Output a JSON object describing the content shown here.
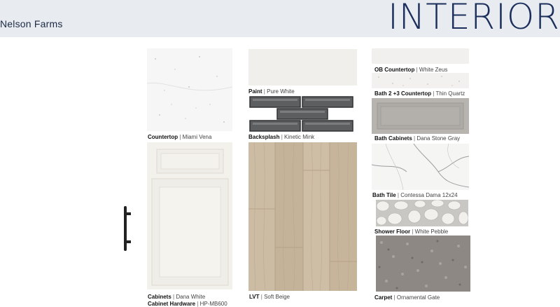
{
  "header": {
    "community": "Nelson Farms",
    "title": "INTERIOR"
  },
  "col1": {
    "countertop": {
      "label": "Countertop",
      "value": "Miami Vena"
    },
    "cabinets": {
      "label": "Cabinets",
      "value": "Dana White"
    },
    "hardware": {
      "label": "Cabinet Hardware",
      "value": "HP-MB600"
    }
  },
  "col2": {
    "paint": {
      "label": "Paint",
      "value": "Pure White"
    },
    "backsplash": {
      "label": "Backsplash",
      "value": "Kinetic Mink"
    },
    "lvt": {
      "label": "LVT",
      "value": "Soft Beige"
    }
  },
  "col3": {
    "ob_countertop": {
      "label": "OB Countertop",
      "value": "White Zeus"
    },
    "bath23_countertop": {
      "label": "Bath 2 +3 Countertop",
      "value": "Thin Quartz"
    },
    "bath_cabinets": {
      "label": "Bath Cabinets",
      "value": "Dana Stone Gray"
    },
    "bath_tile": {
      "label": "Bath Tile",
      "value": "Contessa Dama 12x24"
    },
    "shower_floor": {
      "label": "Shower Floor",
      "value": "White Pebble"
    },
    "carpet": {
      "label": "Carpet",
      "value": "Ornamental Gate"
    }
  },
  "colors": {
    "header_bg": "#e8ecf1",
    "brand": "#1c2f5c"
  }
}
